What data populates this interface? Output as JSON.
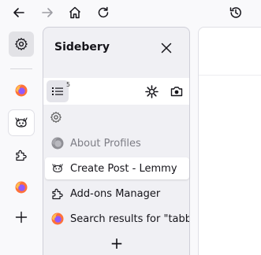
{
  "toolbar": {
    "buttons": [
      {
        "name": "back-button",
        "icon": "arrow-left-icon"
      },
      {
        "name": "forward-button",
        "icon": "arrow-right-icon",
        "disabled": true
      },
      {
        "name": "home-button",
        "icon": "home-icon"
      },
      {
        "name": "reload-button",
        "icon": "reload-icon"
      },
      {
        "name": "history-button",
        "icon": "history-icon"
      }
    ]
  },
  "strip": {
    "items": [
      {
        "name": "settings",
        "icon": "gear-icon",
        "state": "active"
      },
      {
        "name": "firefox-tab",
        "icon": "firefox-icon"
      },
      {
        "name": "lemmy-tab",
        "icon": "lemmy-icon",
        "state": "selected"
      },
      {
        "name": "addons-tab",
        "icon": "puzzle-icon"
      },
      {
        "name": "firefox-tab-2",
        "icon": "firefox-icon"
      },
      {
        "name": "add",
        "icon": "plus-icon"
      }
    ]
  },
  "sidebar": {
    "title": "Sidebery",
    "nav": {
      "panel_count": "5"
    },
    "tabs": [
      {
        "title": "About Profiles",
        "icon": "firefox-grey-icon",
        "state": "discarded"
      },
      {
        "title": "Create Post - Lemmy",
        "icon": "lemmy-icon",
        "state": "active"
      },
      {
        "title": "Add-ons Manager",
        "icon": "puzzle-icon",
        "state": "normal"
      },
      {
        "title": "Search results for \"tabba",
        "icon": "firefox-icon",
        "state": "normal"
      }
    ],
    "new_tab_label": "+"
  },
  "colors": {
    "background": "#f9f9fb",
    "sidebar_bg": "#f0f0f4",
    "active_tab_bg": "#ffffff",
    "text": "#15141a",
    "muted_text": "#7d7d85"
  }
}
